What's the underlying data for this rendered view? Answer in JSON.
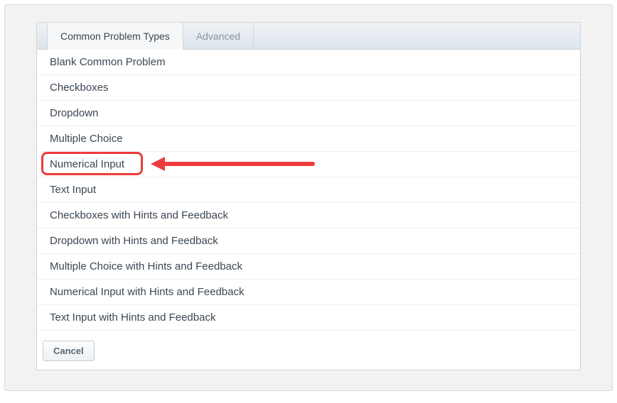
{
  "tabs": {
    "common": "Common Problem Types",
    "advanced": "Advanced"
  },
  "items": [
    "Blank Common Problem",
    "Checkboxes",
    "Dropdown",
    "Multiple Choice",
    "Numerical Input",
    "Text Input",
    "Checkboxes with Hints and Feedback",
    "Dropdown with Hints and Feedback",
    "Multiple Choice with Hints and Feedback",
    "Numerical Input with Hints and Feedback",
    "Text Input with Hints and Feedback"
  ],
  "buttons": {
    "cancel": "Cancel"
  },
  "annotation": {
    "highlight_index": 4,
    "colors": {
      "highlight": "#ee3b3b"
    }
  }
}
